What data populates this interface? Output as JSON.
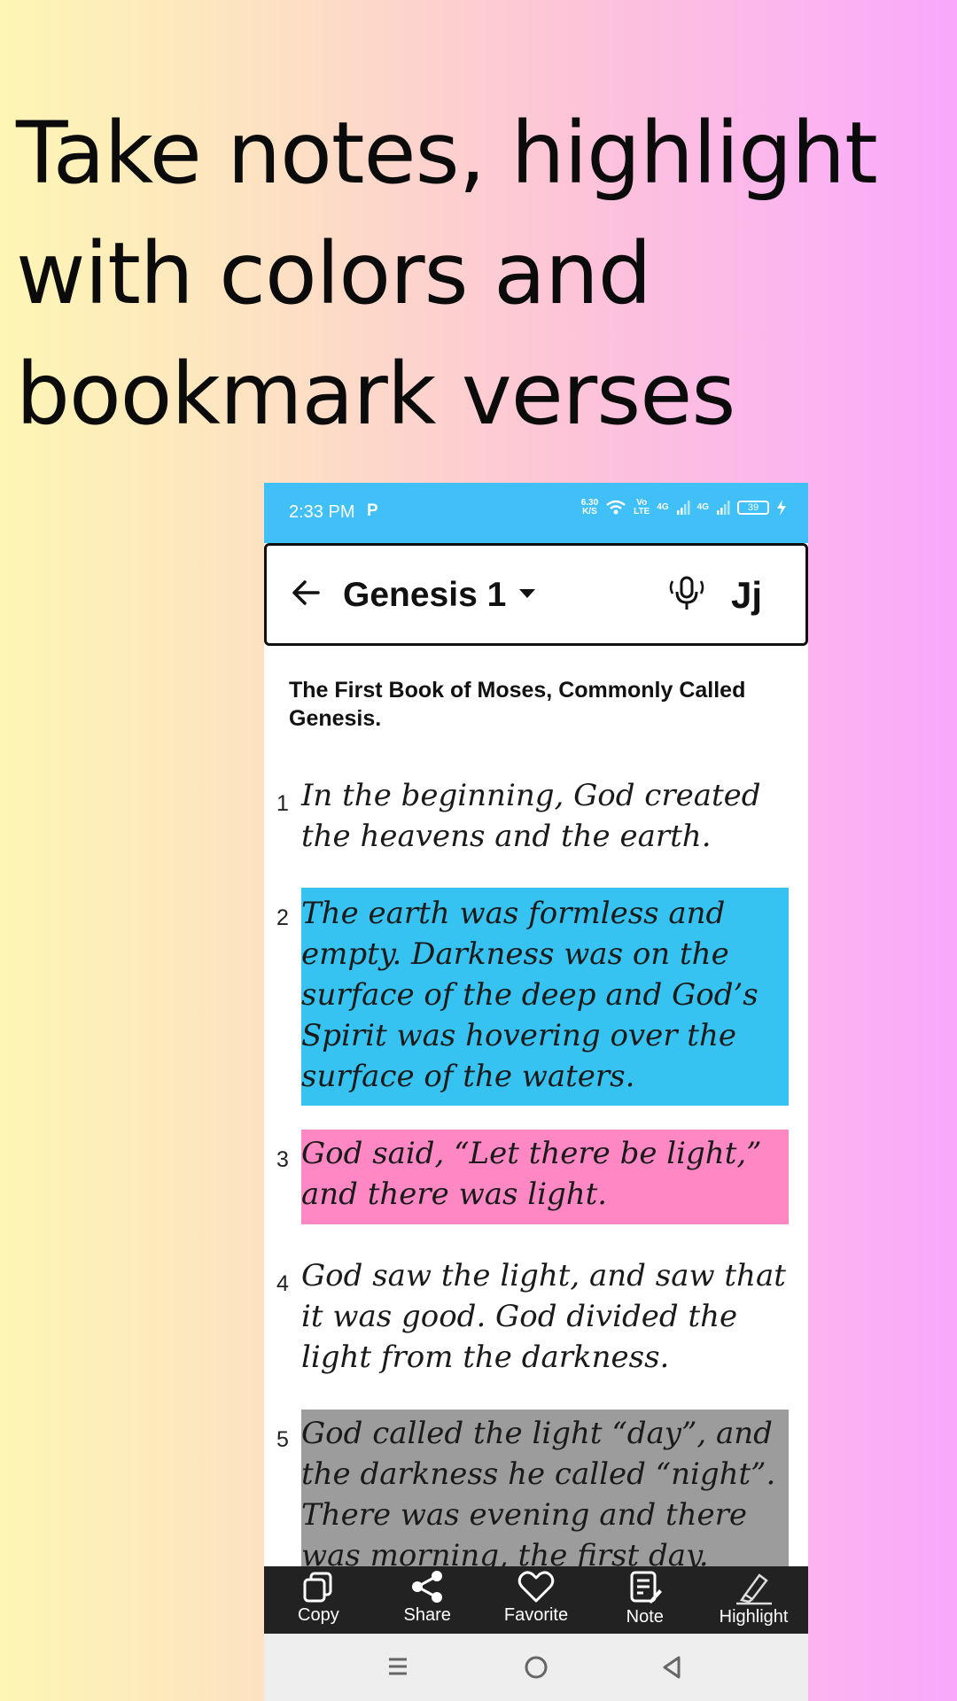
{
  "headline": "Take notes, highlight with colors and bookmark verses",
  "status_bar": {
    "time": "2:33 PM",
    "notification": "P",
    "speed_value": "6.30",
    "speed_unit": "K/S",
    "volte_top": "Vo",
    "volte_bottom": "LTE",
    "net1": "4G",
    "net2": "4G",
    "battery": "39"
  },
  "app_bar": {
    "title": "Genesis 1",
    "font_button": "Jj"
  },
  "book_heading": "The First Book of Moses, Commonly Called Genesis.",
  "verses": [
    {
      "num": "1",
      "text": "In the beginning, God created the heavens and the earth.",
      "highlight": "none"
    },
    {
      "num": "2",
      "text": "The earth was formless and empty. Darkness was on the surface of the deep and God’s Spirit was hovering over the surface of the waters.",
      "highlight": "#36c3f1"
    },
    {
      "num": "3",
      "text": "God said, “Let there be light,” and there was light.",
      "highlight": "#ff88c4"
    },
    {
      "num": "4",
      "text": "God saw the light, and saw that it was good. God divided the light from the darkness.",
      "highlight": "none"
    },
    {
      "num": "5",
      "text": "God called the light “day”, and the darkness he called “night”. There was evening and there was morning, the first day.",
      "highlight": "#9c9c9c"
    }
  ],
  "actions": {
    "copy": "Copy",
    "share": "Share",
    "favorite": "Favorite",
    "note": "Note",
    "highlight": "Highlight"
  },
  "colors": {
    "status_bar": "#40c0f6",
    "action_bar": "#222222"
  }
}
